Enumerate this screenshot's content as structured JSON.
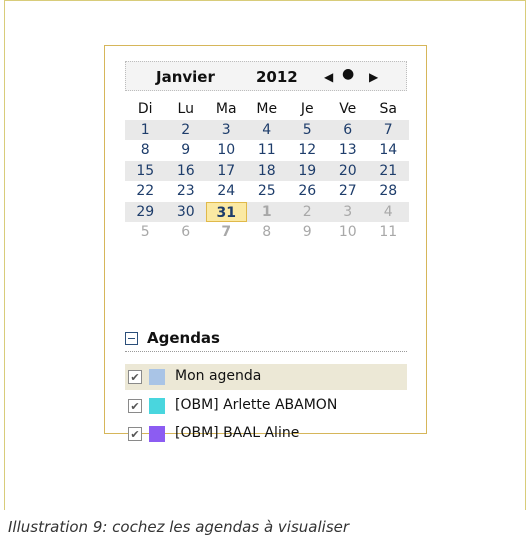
{
  "calendar": {
    "month": "Janvier",
    "year": "2012",
    "nav": {
      "prev": "◀",
      "today": "●",
      "next": "▶"
    },
    "weekdays": [
      "Di",
      "Lu",
      "Ma",
      "Me",
      "Je",
      "Ve",
      "Sa"
    ],
    "weeks": [
      [
        "1",
        "2",
        "3",
        "4",
        "5",
        "6",
        "7"
      ],
      [
        "8",
        "9",
        "10",
        "11",
        "12",
        "13",
        "14"
      ],
      [
        "15",
        "16",
        "17",
        "18",
        "19",
        "20",
        "21"
      ],
      [
        "22",
        "23",
        "24",
        "25",
        "26",
        "27",
        "28"
      ],
      [
        "29",
        "30",
        "31",
        "1",
        "2",
        "3",
        "4"
      ],
      [
        "5",
        "6",
        "7",
        "8",
        "9",
        "10",
        "11"
      ]
    ],
    "selected_day": "31"
  },
  "agendas": {
    "title": "Agendas",
    "items": [
      {
        "name": "Mon agenda",
        "checked": true,
        "color": "#a9c4e6",
        "selected": true
      },
      {
        "name": "[OBM] Arlette ABAMON",
        "checked": true,
        "color": "#49d6de",
        "selected": false
      },
      {
        "name": "[OBM] BAAL Aline",
        "checked": true,
        "color": "#8c5cf2",
        "selected": false
      }
    ]
  },
  "caption": "Illustration 9: cochez les agendas à visualiser"
}
